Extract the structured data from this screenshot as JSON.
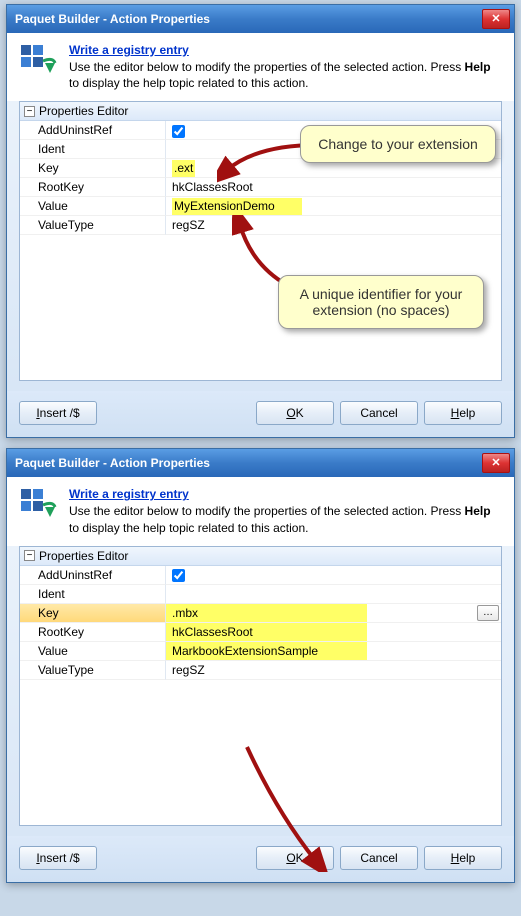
{
  "dialog1": {
    "title": "Paquet Builder - Action Properties",
    "header": {
      "link": "Write a registry entry",
      "desc_before": "Use the editor below to modify the properties of the selected action. Press ",
      "desc_bold": "Help",
      "desc_after": " to display the help topic related to this action."
    },
    "propHeader": "Properties Editor",
    "rows": {
      "addUninstRef": {
        "label": "AddUninstRef",
        "value": true
      },
      "ident": {
        "label": "Ident",
        "value": ""
      },
      "key": {
        "label": "Key",
        "value": ".ext"
      },
      "rootKey": {
        "label": "RootKey",
        "value": "hkClassesRoot"
      },
      "value": {
        "label": "Value",
        "value": "MyExtensionDemo"
      },
      "valueType": {
        "label": "ValueType",
        "value": "regSZ"
      }
    },
    "buttons": {
      "insert": "Insert /$",
      "ok": "OK",
      "cancel": "Cancel",
      "help": "Help"
    },
    "callouts": {
      "top": "Change to your extension",
      "bottom": "A unique identifier for your extension (no spaces)"
    }
  },
  "dialog2": {
    "title": "Paquet Builder - Action Properties",
    "header": {
      "link": "Write a registry entry",
      "desc_before": "Use the editor below to modify the properties of the selected action. Press ",
      "desc_bold": "Help",
      "desc_after": " to display the help topic related to this action."
    },
    "propHeader": "Properties Editor",
    "rows": {
      "addUninstRef": {
        "label": "AddUninstRef",
        "value": true
      },
      "ident": {
        "label": "Ident",
        "value": ""
      },
      "key": {
        "label": "Key",
        "value": ".mbx"
      },
      "rootKey": {
        "label": "RootKey",
        "value": "hkClassesRoot"
      },
      "value": {
        "label": "Value",
        "value": "MarkbookExtensionSample"
      },
      "valueType": {
        "label": "ValueType",
        "value": "regSZ"
      }
    },
    "buttons": {
      "insert": "Insert /$",
      "ok": "OK",
      "cancel": "Cancel",
      "help": "Help"
    }
  }
}
